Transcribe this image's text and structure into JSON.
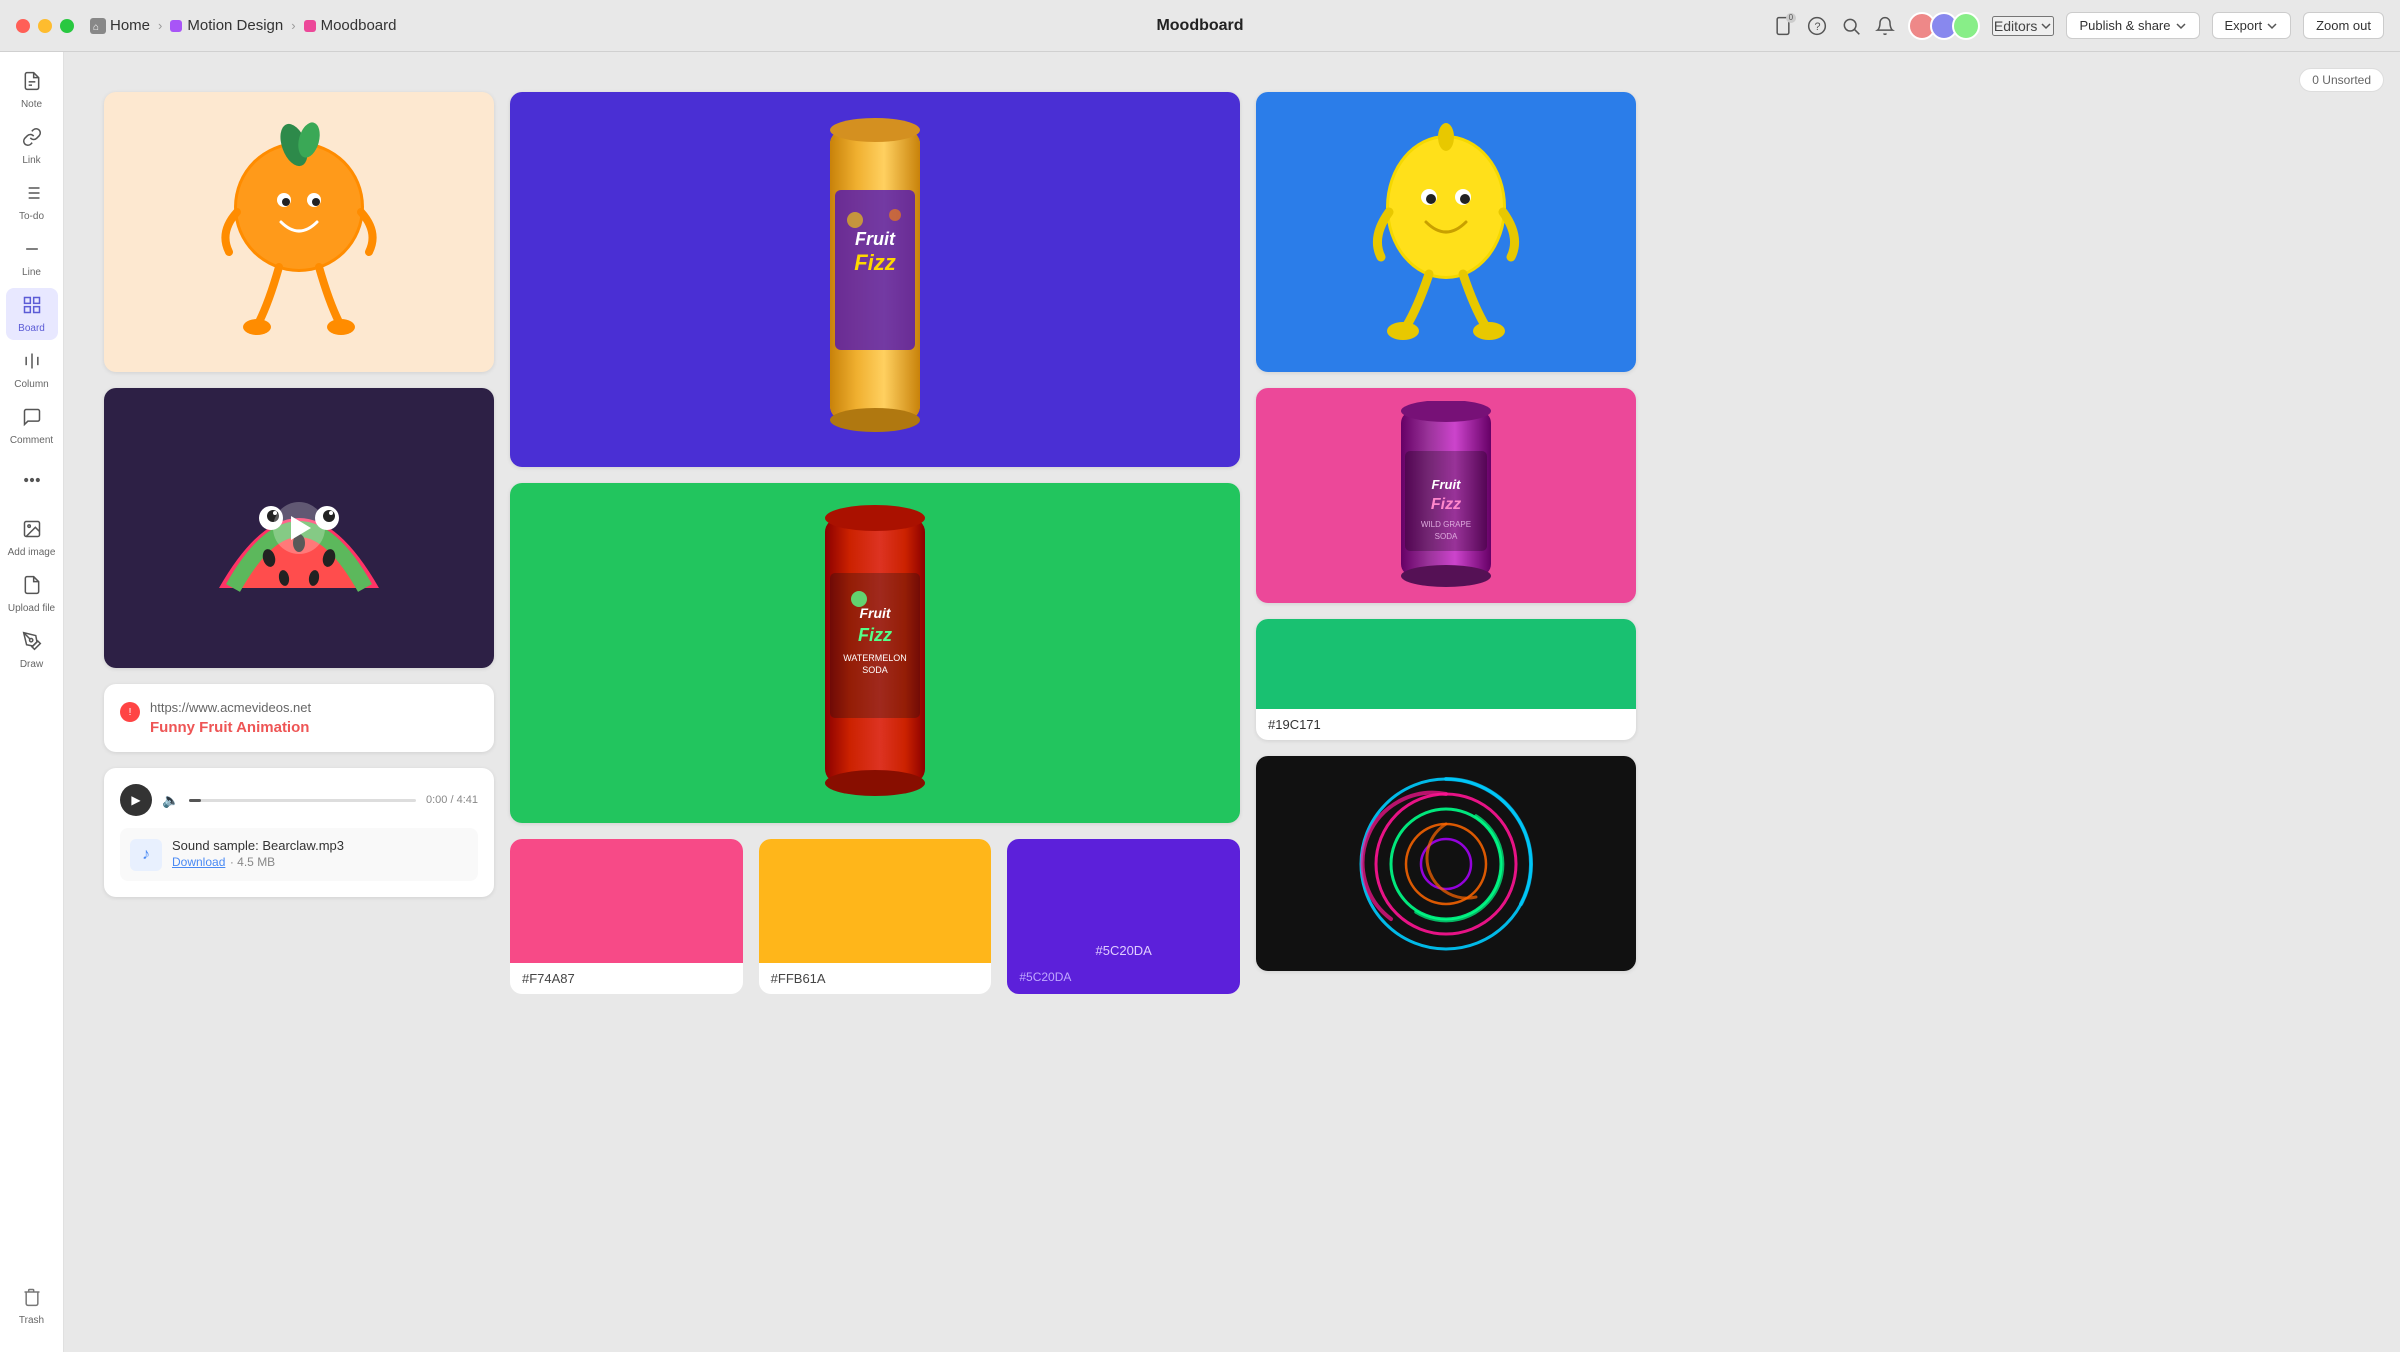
{
  "titlebar": {
    "home_label": "Home",
    "breadcrumb1": "Motion Design",
    "breadcrumb2": "Moodboard",
    "page_title": "Moodboard",
    "editors_label": "Editors",
    "publish_label": "Publish & share",
    "export_label": "Export",
    "zoom_label": "Zoom out",
    "notification_count": "0"
  },
  "sidebar": {
    "note_label": "Note",
    "link_label": "Link",
    "todo_label": "To-do",
    "line_label": "Line",
    "board_label": "Board",
    "column_label": "Column",
    "comment_label": "Comment",
    "more_label": "···",
    "add_image_label": "Add image",
    "upload_label": "Upload file",
    "draw_label": "Draw",
    "trash_label": "Trash"
  },
  "canvas": {
    "unsorted_label": "0 Unsorted"
  },
  "cards": {
    "link_url": "https://www.acmevideos.net",
    "link_title": "Funny Fruit Animation",
    "audio_filename": "Sound sample: Bearclaw.mp3",
    "audio_download": "Download",
    "audio_size": "4.5 MB",
    "audio_time": "0:00 / 4:41",
    "green_swatch_hex": "#19C171",
    "swatch1_hex": "#F74A87",
    "swatch2_hex": "#FFB61A",
    "swatch3_hex": "#5C20DA",
    "swatch3_label": "#5C20DA"
  },
  "colors": {
    "swatch_pink": "#F74A87",
    "swatch_yellow": "#FFB61A",
    "swatch_purple": "#5C20DA",
    "swatch_green": "#19C171",
    "bg_orange_char": "#fde8d0",
    "bg_purple_can": "#4a2fd4",
    "bg_blue_lemon": "#2b7de9",
    "bg_dark_watermelon": "#2d2045",
    "bg_green_can": "#22c55e",
    "bg_pink_can": "#ec4899",
    "bg_black_spiral": "#111111"
  }
}
